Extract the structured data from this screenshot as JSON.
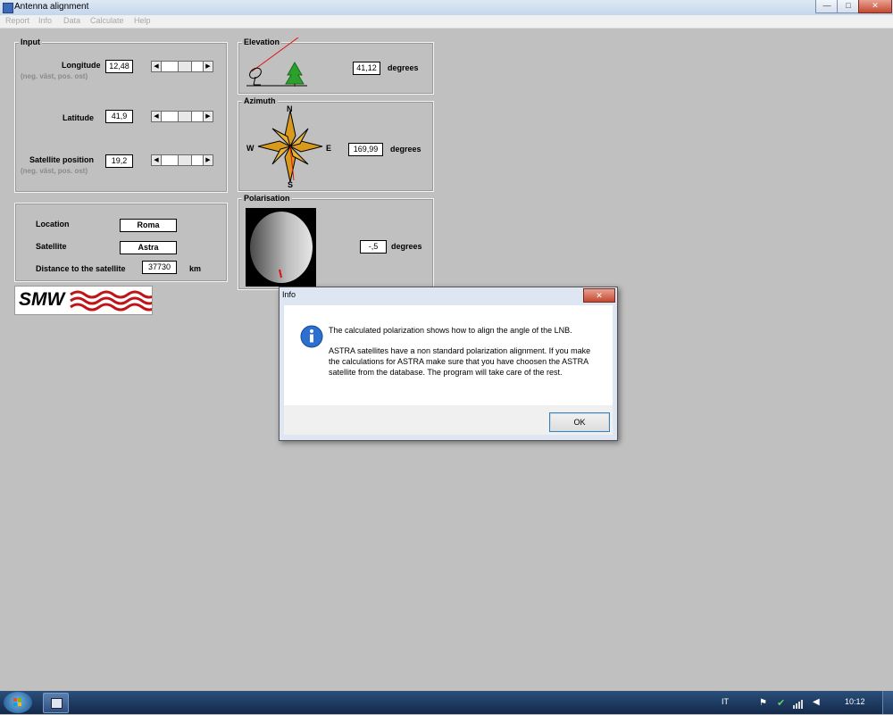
{
  "window": {
    "title": "Antenna alignment",
    "minimize": "—",
    "maximize": "□",
    "close": "✕"
  },
  "menu": [
    "Report",
    "Info",
    "Data",
    "Calculate",
    "Help"
  ],
  "input": {
    "title": "Input",
    "longitude": {
      "label": "Longitude",
      "hint": "(neg. väst, pos. ost)",
      "value": "12,48"
    },
    "latitude": {
      "label": "Latitude",
      "value": "41,9"
    },
    "satellite_position": {
      "label": "Satellite position",
      "hint": "(neg. väst, pos. ost)",
      "value": "19,2"
    }
  },
  "info_panel": {
    "location": {
      "label": "Location",
      "value": "Roma"
    },
    "satellite": {
      "label": "Satellite",
      "value": "Astra"
    },
    "distance": {
      "label": "Distance to the satellite",
      "value": "37730",
      "unit": "km"
    }
  },
  "logo": {
    "text": "SMW"
  },
  "elevation": {
    "title": "Elevation",
    "value": "41,12",
    "unit": "degrees"
  },
  "azimuth": {
    "title": "Azimuth",
    "value": "169,99",
    "unit": "degrees",
    "compass": {
      "n": "N",
      "s": "S",
      "e": "E",
      "w": "W"
    }
  },
  "polarisation": {
    "title": "Polarisation",
    "value": "-,5",
    "unit": "degrees"
  },
  "dialog": {
    "title": "Info",
    "line1": "The calculated polarization shows how to align the angle of the LNB.",
    "line2": "ASTRA satellites have a non standard polarization alignment. If you make the calculations for ASTRA make sure that you have choosen the ASTRA satellite from the database. The program will take care of the rest.",
    "ok": "OK",
    "close": "✕",
    "icon": "info-icon"
  },
  "taskbar": {
    "language": "IT",
    "time": "10:12"
  }
}
